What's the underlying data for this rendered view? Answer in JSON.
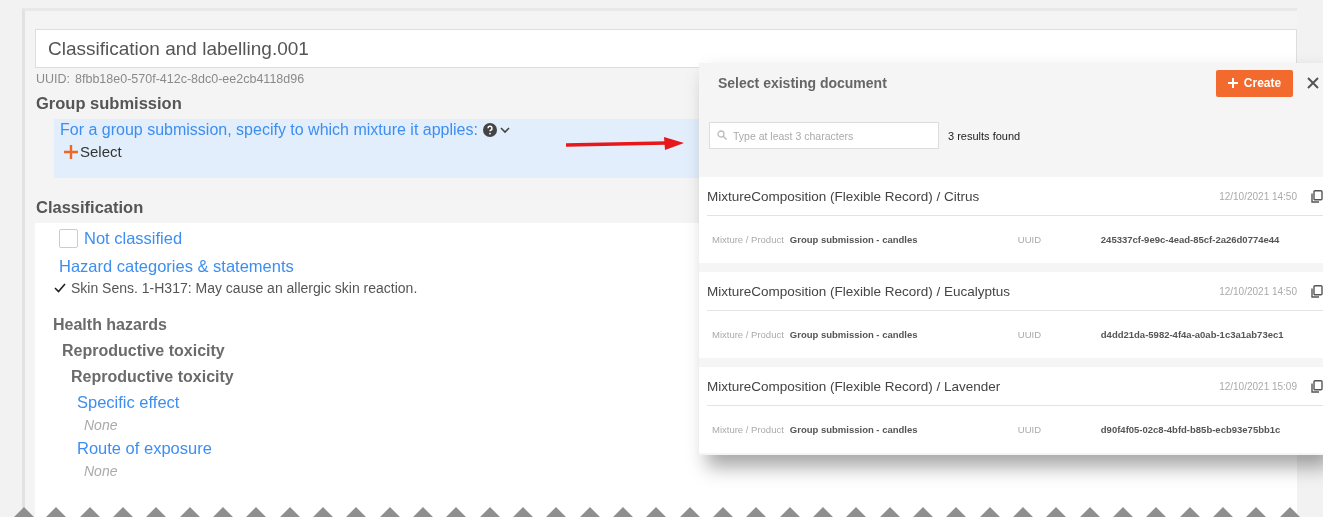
{
  "record": {
    "title": "Classification and labelling.001",
    "uuid_label": "UUID:",
    "uuid": "8fbb18e0-570f-412c-8dc0-ee2cb4118d96"
  },
  "group_submission": {
    "heading": "Group submission",
    "question": "For a group submission, specify to which mixture it applies:",
    "select_label": "Select"
  },
  "classification": {
    "heading": "Classification",
    "not_classified": {
      "label": "Not classified",
      "checked": false
    },
    "hazard_heading": "Hazard categories & statements",
    "statements": [
      {
        "text": "Skin Sens. 1-H317: May cause an allergic skin reaction.",
        "checked": true
      }
    ],
    "hazards": [
      {
        "label": "Health hazards",
        "children": [
          {
            "label": "Reproductive toxicity",
            "children": [
              {
                "label": "Reproductive toxicity",
                "fields": [
                  {
                    "label": "Specific effect",
                    "value": "None"
                  },
                  {
                    "label": "Route of exposure",
                    "value": "None"
                  }
                ]
              }
            ]
          }
        ]
      }
    ]
  },
  "dialog": {
    "title": "Select existing document",
    "create_label": "Create",
    "search": {
      "placeholder": "Type at least 3 characters"
    },
    "results_count": "3 results found",
    "results": [
      {
        "title": "MixtureComposition (Flexible Record) / Citrus",
        "date": "12/10/2021 14:50",
        "type_label": "Mixture / Product",
        "type_value": "Group submission - candles",
        "uuid_label": "UUID",
        "uuid": "245337cf-9e9c-4ead-85cf-2a26d0774e44"
      },
      {
        "title": "MixtureComposition (Flexible Record) / Eucalyptus",
        "date": "12/10/2021 14:50",
        "type_label": "Mixture / Product",
        "type_value": "Group submission - candles",
        "uuid_label": "UUID",
        "uuid": "d4dd21da-5982-4f4a-a0ab-1c3a1ab73ec1"
      },
      {
        "title": "MixtureComposition (Flexible Record) / Lavender",
        "date": "12/10/2021 15:09",
        "type_label": "Mixture / Product",
        "type_value": "Group submission - candles",
        "uuid_label": "UUID",
        "uuid": "d90f4f05-02c8-4bfd-b85b-ecb93e75bb1c"
      }
    ]
  }
}
